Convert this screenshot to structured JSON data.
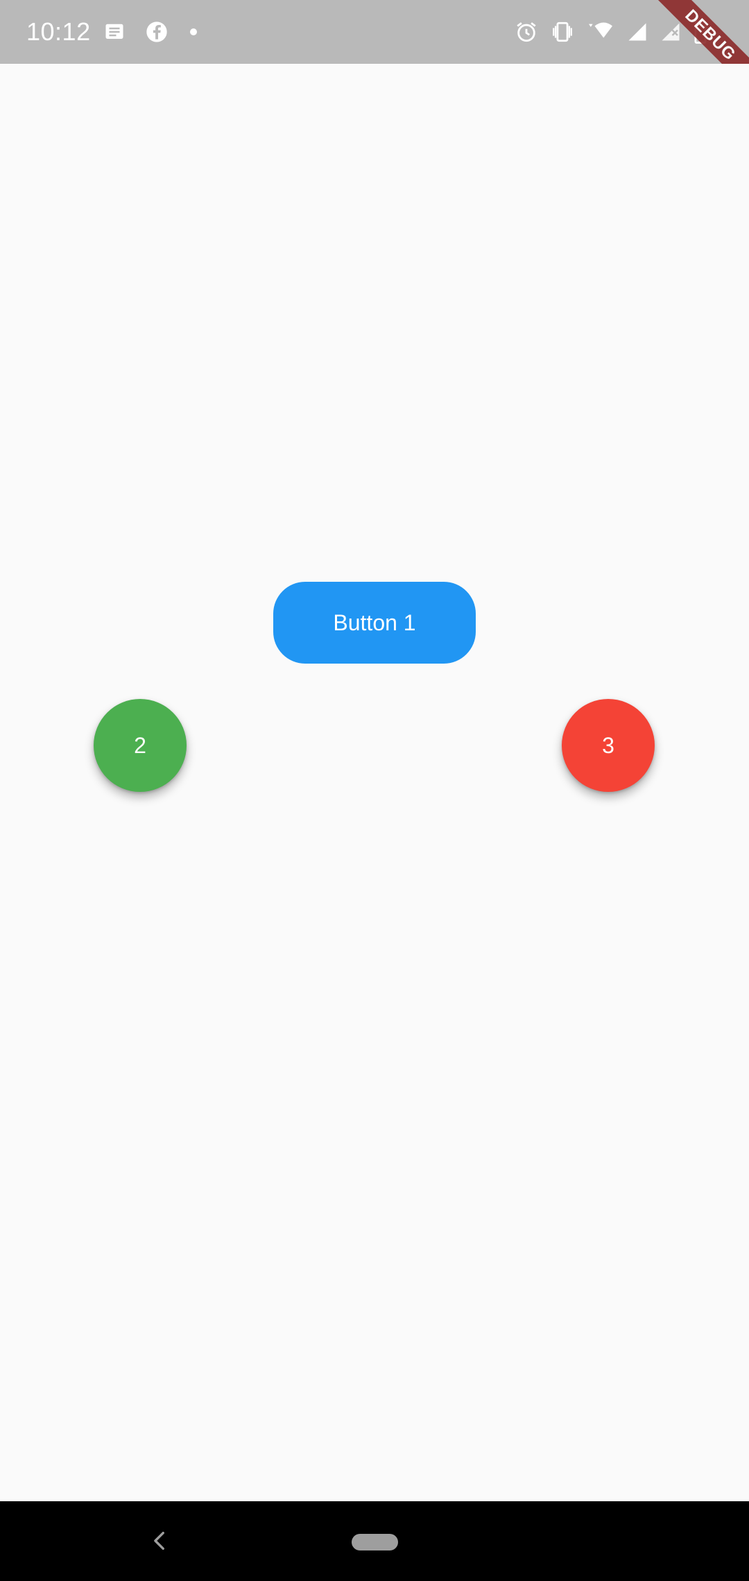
{
  "status_bar": {
    "time": "10:12",
    "left_icons": [
      "message-icon",
      "facebook-icon",
      "dot-icon"
    ],
    "right_icons": [
      "alarm-icon",
      "vibrate-icon",
      "wifi-icon",
      "signal-icon",
      "signal-alt-icon",
      "battery-icon"
    ],
    "wifi_badge": "4",
    "background": "#b9b9b9"
  },
  "debug_banner": {
    "label": "DEBUG"
  },
  "main": {
    "button_1": {
      "label": "Button 1",
      "color": "#2196f3"
    },
    "button_2": {
      "label": "2",
      "color": "#4caf50"
    },
    "button_3": {
      "label": "3",
      "color": "#f44336"
    }
  },
  "nav_bar": {
    "back": "back-icon",
    "home": "home-pill"
  }
}
